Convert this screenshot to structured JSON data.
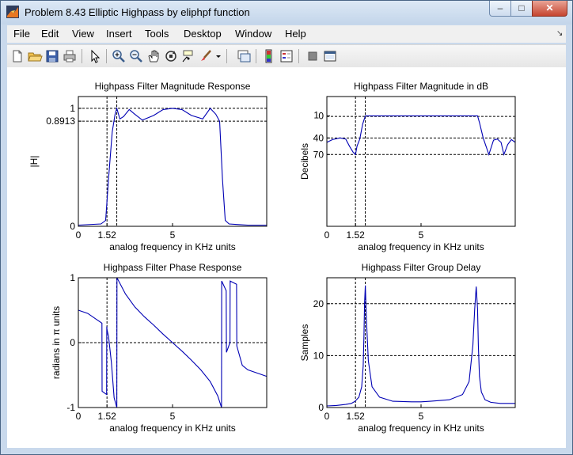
{
  "window": {
    "title": "Problem 8.43 Elliptic Highpass by eliphpf function",
    "min_glyph": "–",
    "max_glyph": "□",
    "close_glyph": "✕"
  },
  "menu": [
    "File",
    "Edit",
    "View",
    "Insert",
    "Tools",
    "Desktop",
    "Window",
    "Help"
  ],
  "menu_overflow": "↘",
  "toolbar": [
    "new-file-icon",
    "open-folder-icon",
    "save-icon",
    "print-icon",
    "pointer-icon",
    "zoom-in-icon",
    "zoom-out-icon",
    "pan-icon",
    "rotate-3d-icon",
    "data-cursor-icon",
    "brush-icon",
    "brush-dropdown-icon",
    "link-plot-icon",
    "colorbar-icon",
    "legend-icon",
    "hide-plot-tools-icon",
    "show-plot-tools-icon"
  ],
  "colors": {
    "curve": "#0000b4",
    "axes": "#000000"
  },
  "chart_data": [
    {
      "type": "line",
      "title": "Highpass Filter Magnitude Response",
      "xlabel": "analog frequency in KHz units",
      "ylabel": "|H|",
      "xlim": [
        0,
        10
      ],
      "ylim": [
        0,
        1.1
      ],
      "xticks": [
        0,
        1.52,
        5
      ],
      "xtick_labels": [
        "0",
        "1.52",
        "5"
      ],
      "yticks": [
        0,
        0.8913,
        1
      ],
      "ytick_labels": [
        "0",
        "0.8913",
        "1"
      ],
      "grid_lines": {
        "x": [
          1.52,
          2.04
        ],
        "y": [
          0.8913,
          1
        ]
      },
      "series": [
        {
          "x": [
            0,
            1.2,
            1.45,
            1.6,
            1.8,
            1.95,
            2.04,
            2.2,
            2.4,
            2.7,
            3.0,
            3.4,
            4.0,
            4.5,
            5.0,
            5.5,
            6.0,
            6.6,
            7.0,
            7.3,
            7.5,
            7.65,
            7.8,
            8.0,
            8.5,
            9.0,
            10
          ],
          "y": [
            0.01,
            0.02,
            0.05,
            0.4,
            0.8,
            0.95,
            1.0,
            0.91,
            0.93,
            0.99,
            0.95,
            0.9,
            0.94,
            0.99,
            1.0,
            0.99,
            0.94,
            0.91,
            1.0,
            0.95,
            0.89,
            0.4,
            0.05,
            0.02,
            0.015,
            0.01,
            0.01
          ]
        }
      ]
    },
    {
      "type": "line",
      "title": "Highpass Filter Magnitude in dB",
      "xlabel": "analog frequency in KHz units",
      "ylabel": "Decibels",
      "xlim": [
        0,
        10
      ],
      "ylim": [
        -200,
        35
      ],
      "xticks": [
        0,
        1.52,
        5
      ],
      "xtick_labels": [
        "0",
        "1.52",
        "5"
      ],
      "yticks": [
        0,
        -40,
        -70
      ],
      "ytick_labels": [
        "0",
        "40",
        "70"
      ],
      "extra_tick_labels": [
        "1"
      ],
      "grid_lines": {
        "x": [
          1.52,
          2.04
        ],
        "y": [
          -1,
          -40,
          -70
        ]
      },
      "series": [
        {
          "x": [
            0,
            0.3,
            0.7,
            1.0,
            1.2,
            1.4,
            1.52,
            1.6,
            1.75,
            1.9,
            2.04,
            2.1,
            3.0,
            5.0,
            7.0,
            8.0,
            8.1,
            8.3,
            8.45,
            8.6,
            8.85,
            9.05,
            9.25,
            9.4,
            9.6,
            9.8,
            10
          ],
          "y": [
            -48,
            -43,
            -40,
            -42,
            -55,
            -66,
            -70,
            -55,
            -42,
            -15,
            0,
            0,
            0,
            0,
            0,
            0,
            -12,
            -40,
            -55,
            -70,
            -44,
            -42,
            -48,
            -70,
            -52,
            -43,
            -48
          ]
        }
      ]
    },
    {
      "type": "line",
      "title": "Highpass Filter Phase Response",
      "xlabel": "analog frequency in KHz units",
      "ylabel": "radians in π units",
      "xlim": [
        0,
        10
      ],
      "ylim": [
        -1,
        1
      ],
      "xticks": [
        0,
        1.52,
        5
      ],
      "xtick_labels": [
        "0",
        "1.52",
        "5"
      ],
      "yticks": [
        -1,
        0,
        1
      ],
      "ytick_labels": [
        "-1",
        "0",
        "1"
      ],
      "grid_lines": {
        "x": [
          1.52,
          2.04
        ],
        "y": [
          -1,
          0,
          1
        ]
      },
      "series": [
        {
          "x": [
            0,
            0.5,
            1.0,
            1.25,
            1.26,
            1.5,
            1.51,
            1.52,
            1.6,
            1.75,
            1.9,
            2.04,
            2.05,
            2.5,
            3.0,
            3.5,
            4.0,
            4.5,
            5.0,
            5.5,
            6.0,
            6.5,
            7.0,
            7.4,
            7.6,
            7.61,
            7.85,
            7.86,
            8.05,
            8.06,
            8.4,
            8.41,
            8.7,
            9.0,
            9.5,
            10
          ],
          "y": [
            0.5,
            0.45,
            0.35,
            0.3,
            -0.75,
            -0.8,
            0.25,
            0.2,
            0.1,
            -0.3,
            -0.85,
            -1.0,
            1.0,
            0.75,
            0.55,
            0.4,
            0.27,
            0.13,
            0.0,
            -0.13,
            -0.27,
            -0.42,
            -0.6,
            -0.82,
            -1.0,
            0.95,
            0.8,
            -0.15,
            0.0,
            0.95,
            0.9,
            -0.05,
            -0.35,
            -0.42,
            -0.47,
            -0.52
          ]
        }
      ]
    },
    {
      "type": "line",
      "title": "Highpass Filter Group Delay",
      "xlabel": "analog frequency in KHz units",
      "ylabel": "Samples",
      "xlim": [
        0,
        10
      ],
      "ylim": [
        0,
        25
      ],
      "xticks": [
        0,
        1.52,
        5
      ],
      "xtick_labels": [
        "0",
        "1.52",
        "5"
      ],
      "yticks": [
        0,
        10,
        20
      ],
      "ytick_labels": [
        "0",
        "10",
        "20"
      ],
      "grid_lines": {
        "x": [
          1.52,
          2.04
        ],
        "y": [
          0,
          10,
          20
        ]
      },
      "series": [
        {
          "x": [
            0,
            0.5,
            1.0,
            1.3,
            1.5,
            1.7,
            1.85,
            1.93,
            1.97,
            2.0,
            2.04,
            2.1,
            2.2,
            2.4,
            2.8,
            3.5,
            4.5,
            5.0,
            5.5,
            6.5,
            7.2,
            7.55,
            7.75,
            7.85,
            7.93,
            8.0,
            8.04,
            8.1,
            8.2,
            8.4,
            8.7,
            9.2,
            10
          ],
          "y": [
            0.3,
            0.4,
            0.6,
            0.8,
            1.2,
            2.0,
            4.0,
            8.0,
            14.0,
            20.0,
            23.5,
            17.0,
            9.0,
            4.0,
            2.0,
            1.2,
            1.1,
            1.1,
            1.2,
            1.5,
            2.5,
            5.0,
            12.0,
            19.0,
            23.3,
            19.0,
            12.0,
            6.0,
            3.0,
            1.5,
            1.0,
            0.8,
            0.8
          ]
        }
      ]
    }
  ]
}
